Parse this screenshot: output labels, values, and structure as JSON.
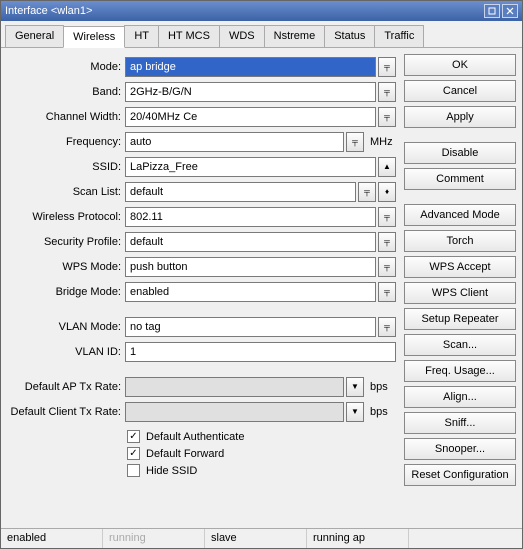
{
  "window": {
    "title": "Interface <wlan1>"
  },
  "tabs": [
    "General",
    "Wireless",
    "HT",
    "HT MCS",
    "WDS",
    "Nstreme",
    "Status",
    "Traffic"
  ],
  "active_tab_index": 1,
  "form": {
    "mode": {
      "label": "Mode:",
      "value": "ap bridge"
    },
    "band": {
      "label": "Band:",
      "value": "2GHz-B/G/N"
    },
    "channel_width": {
      "label": "Channel Width:",
      "value": "20/40MHz Ce"
    },
    "frequency": {
      "label": "Frequency:",
      "value": "auto",
      "unit": "MHz"
    },
    "ssid": {
      "label": "SSID:",
      "value": "LaPizza_Free"
    },
    "scan_list": {
      "label": "Scan List:",
      "value": "default"
    },
    "wireless_protocol": {
      "label": "Wireless Protocol:",
      "value": "802.11"
    },
    "security_profile": {
      "label": "Security Profile:",
      "value": "default"
    },
    "wps_mode": {
      "label": "WPS Mode:",
      "value": "push button"
    },
    "bridge_mode": {
      "label": "Bridge Mode:",
      "value": "enabled"
    },
    "vlan_mode": {
      "label": "VLAN Mode:",
      "value": "no tag"
    },
    "vlan_id": {
      "label": "VLAN ID:",
      "value": "1"
    },
    "default_ap_tx": {
      "label": "Default AP Tx Rate:",
      "value": "",
      "unit": "bps"
    },
    "default_client_tx": {
      "label": "Default Client Tx Rate:",
      "value": "",
      "unit": "bps"
    },
    "default_authenticate": {
      "label": "Default Authenticate",
      "checked": true
    },
    "default_forward": {
      "label": "Default Forward",
      "checked": true
    },
    "hide_ssid": {
      "label": "Hide SSID",
      "checked": false
    }
  },
  "buttons": {
    "ok": "OK",
    "cancel": "Cancel",
    "apply": "Apply",
    "disable": "Disable",
    "comment": "Comment",
    "advanced_mode": "Advanced Mode",
    "torch": "Torch",
    "wps_accept": "WPS Accept",
    "wps_client": "WPS Client",
    "setup_repeater": "Setup Repeater",
    "scan": "Scan...",
    "freq_usage": "Freq. Usage...",
    "align": "Align...",
    "sniff": "Sniff...",
    "snooper": "Snooper...",
    "reset_config": "Reset Configuration"
  },
  "status": [
    "enabled",
    "running",
    "slave",
    "running ap",
    ""
  ]
}
